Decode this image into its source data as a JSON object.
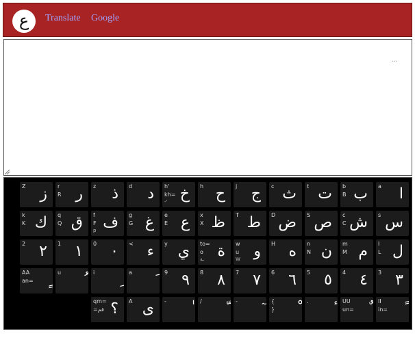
{
  "header": {
    "logo_char": "ع",
    "nav": [
      "Translate",
      "Google"
    ]
  },
  "editor": {
    "ellipsis": "..."
  },
  "keyboard": {
    "rows": [
      [
        {
          "ar": "ز",
          "l1": "Z"
        },
        {
          "ar": "ر",
          "l1": "r",
          "l2": "R"
        },
        {
          "ar": "ذ",
          "l1": "z"
        },
        {
          "ar": "د",
          "l1": "d"
        },
        {
          "ar": "خ",
          "l1": "h'",
          "l2": "kh=",
          "l3": "-'"
        },
        {
          "ar": "ح",
          "l1": "h"
        },
        {
          "ar": "ج",
          "l1": "j"
        },
        {
          "ar": "ث",
          "l1": "c"
        },
        {
          "ar": "ت",
          "l1": "t"
        },
        {
          "ar": "ب",
          "l1": "b",
          "l2": "B"
        },
        {
          "ar": "ا",
          "l1": "a"
        }
      ],
      [
        {
          "ar": "ك",
          "l1": "k",
          "l2": "K"
        },
        {
          "ar": "ق",
          "l1": "q",
          "l2": "Q"
        },
        {
          "ar": "ف",
          "l1": "f",
          "l2": "F",
          "l3": "p"
        },
        {
          "ar": "غ",
          "l1": "g",
          "l2": "G"
        },
        {
          "ar": "ع",
          "l1": "e",
          "l2": "E"
        },
        {
          "ar": "ظ",
          "l1": "x",
          "l2": "X"
        },
        {
          "ar": "ط",
          "l1": "T"
        },
        {
          "ar": "ض",
          "l1": "D"
        },
        {
          "ar": "ص",
          "l1": "S"
        },
        {
          "ar": "ش",
          "l1": "c",
          "l2": "C"
        },
        {
          "ar": "س",
          "l1": "s"
        }
      ],
      [
        {
          "ar": "٢",
          "l1": "2"
        },
        {
          "ar": "١",
          "l1": "1"
        },
        {
          "ar": "٠",
          "l1": "0"
        },
        {
          "ar": "ء",
          "l1": "<"
        },
        {
          "ar": "ي",
          "l1": "y"
        },
        {
          "ar": "ة",
          "l1": "to=",
          "l2": "o",
          "l3": "ـة"
        },
        {
          "ar": "و",
          "l1": "w",
          "l2": "u",
          "l3": "W"
        },
        {
          "ar": "ه",
          "l1": "H"
        },
        {
          "ar": "ن",
          "l1": "n",
          "l2": "N"
        },
        {
          "ar": "م",
          "l1": "m",
          "l2": "M"
        },
        {
          "ar": "ل",
          "l1": "l",
          "l2": "L"
        }
      ],
      [
        {
          "ar": "ٍ",
          "l1": "AA",
          "l2": "an="
        },
        {
          "ar": "ُ",
          "l1": "u"
        },
        {
          "ar": "ِ",
          "l1": "i"
        },
        {
          "ar": "َ",
          "l1": "a"
        },
        {
          "ar": "٩",
          "l1": "9"
        },
        {
          "ar": "٨",
          "l1": "8"
        },
        {
          "ar": "٧",
          "l1": "7"
        },
        {
          "ar": "٦",
          "l1": "6"
        },
        {
          "ar": "٥",
          "l1": "5"
        },
        {
          "ar": "٤",
          "l1": "4"
        },
        {
          "ar": "٣",
          "l1": "3"
        }
      ],
      [
        {
          "ar": "؟",
          "l1": "qm=",
          "l2": "=قم"
        },
        {
          "ar": "ى",
          "l1": "A"
        },
        {
          "ar": "ٰ",
          "l1": "-"
        },
        {
          "ar": "ّ",
          "l1": "/"
        },
        {
          "ar": "ٓ",
          "l1": "-"
        },
        {
          "ar": "ْ",
          "l1": "{",
          "l2": "}"
        },
        {
          "ar": "ٔ",
          "l1": "."
        },
        {
          "ar": "ٌ",
          "l1": "UU",
          "l2": "un="
        },
        {
          "ar": "ً",
          "l1": "II",
          "l2": "in="
        }
      ]
    ]
  }
}
